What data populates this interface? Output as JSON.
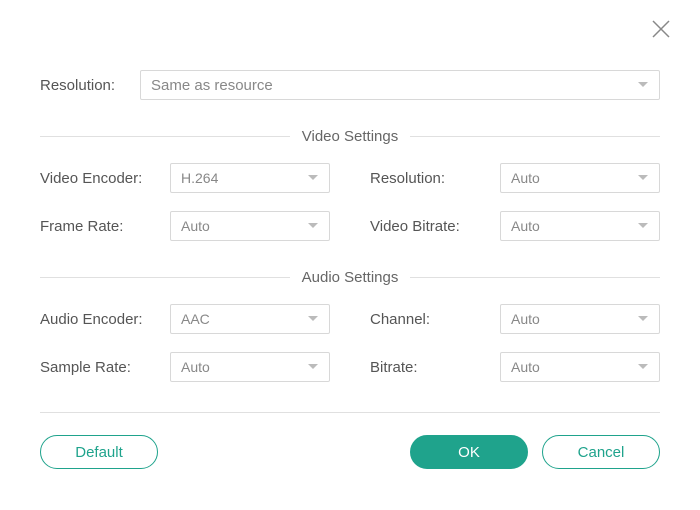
{
  "closeIcon": "close-icon",
  "top": {
    "resolutionLabel": "Resolution:",
    "resolutionValue": "Same as resource"
  },
  "videoSection": {
    "title": "Video Settings",
    "encoderLabel": "Video Encoder:",
    "encoderValue": "H.264",
    "resolutionLabel": "Resolution:",
    "resolutionValue": "Auto",
    "frameRateLabel": "Frame Rate:",
    "frameRateValue": "Auto",
    "bitrateLabel": "Video Bitrate:",
    "bitrateValue": "Auto"
  },
  "audioSection": {
    "title": "Audio Settings",
    "encoderLabel": "Audio Encoder:",
    "encoderValue": "AAC",
    "channelLabel": "Channel:",
    "channelValue": "Auto",
    "sampleRateLabel": "Sample Rate:",
    "sampleRateValue": "Auto",
    "bitrateLabel": "Bitrate:",
    "bitrateValue": "Auto"
  },
  "buttons": {
    "default": "Default",
    "ok": "OK",
    "cancel": "Cancel"
  }
}
